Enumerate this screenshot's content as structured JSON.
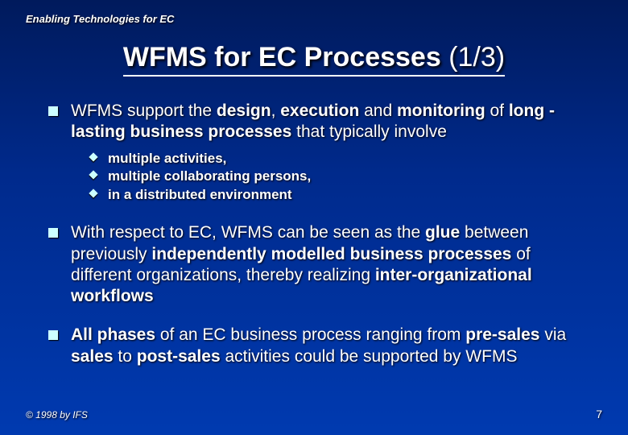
{
  "header": {
    "label": "Enabling Technologies for EC"
  },
  "title": {
    "main": "WFMS for EC Processes",
    "page": "(1/3)"
  },
  "bullets": {
    "b1": {
      "html": "WFMS support the <b>design</b>, <b>execution</b> and <b>monitoring</b> of <b>long -lasting business processes</b> that typically involve",
      "sub": [
        {
          "html": "multiple <b>activities</b>,"
        },
        {
          "html": "multiple collaborating <b>persons</b>,"
        },
        {
          "html": "in a <b>distributed environment</b>"
        }
      ]
    },
    "b2": {
      "html": "With respect to EC, WFMS can be seen as the <b>glue</b> between previously <b>independently modelled business processes</b> of different organizations, thereby realizing <b>inter-organizational workflows</b>"
    },
    "b3": {
      "html": "<b>All phases</b> of an EC business process ranging from <b>pre-sales</b> via <b>sales</b> to <b>post-sales</b> activities could be supported by WFMS"
    }
  },
  "footer": {
    "copyright": "© 1998 by IFS",
    "page": "7"
  }
}
